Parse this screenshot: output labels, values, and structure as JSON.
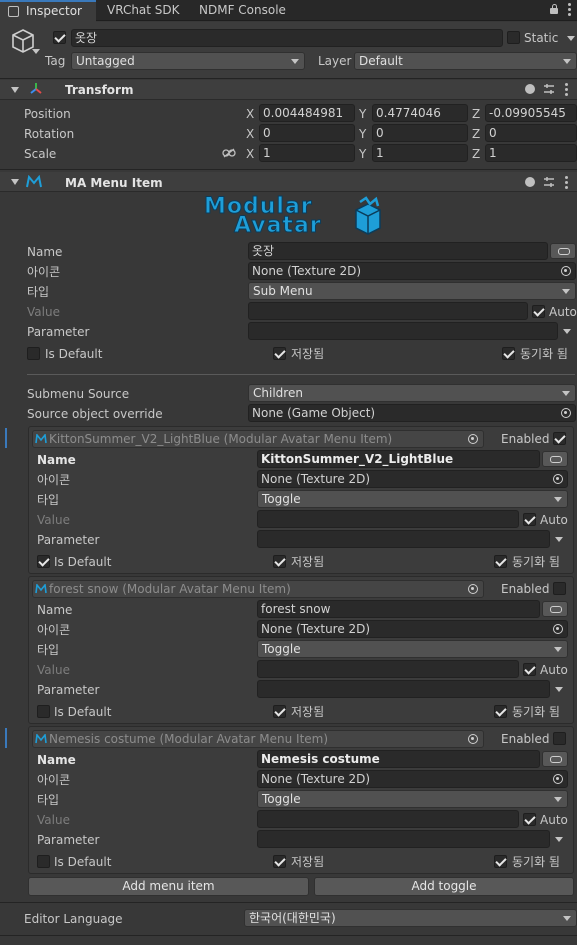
{
  "tabs": {
    "inspector": "Inspector",
    "vrchat_sdk": "VRChat SDK",
    "ndmf_console": "NDMF Console"
  },
  "object": {
    "name": "옷장",
    "static_label": "Static",
    "tag_label": "Tag",
    "tag_value": "Untagged",
    "layer_label": "Layer",
    "layer_value": "Default"
  },
  "transform": {
    "title": "Transform",
    "position_label": "Position",
    "rotation_label": "Rotation",
    "scale_label": "Scale",
    "x": "X",
    "y": "Y",
    "z": "Z",
    "position": [
      "0.004484981",
      "0.4774046",
      "-0.09905545"
    ],
    "rotation": [
      "0",
      "0",
      "0"
    ],
    "scale": [
      "1",
      "1",
      "1"
    ]
  },
  "menu_item": {
    "title": "MA Menu Item",
    "logo_line1": "Modular",
    "logo_line2": "Avatar",
    "name_label": "Name",
    "name_value": "옷장",
    "icon_label": "아이콘",
    "icon_value": "None (Texture 2D)",
    "type_label": "타입",
    "type_value": "Sub Menu",
    "value_label": "Value",
    "auto_label": "Auto",
    "parameter_label": "Parameter",
    "is_default_label": "Is Default",
    "saved_label": "저장됨",
    "synced_label": "동기화 됨",
    "submenu_source_label": "Submenu Source",
    "submenu_source_value": "Children",
    "source_override_label": "Source object override",
    "source_override_value": "None (Game Object)",
    "children": [
      {
        "header": "KittonSummer_V2_LightBlue (Modular Avatar Menu Item)",
        "enabled_label": "Enabled",
        "name_value": "KittonSummer_V2_LightBlue",
        "icon_value": "None (Texture 2D)",
        "type_value": "Toggle"
      },
      {
        "header": "forest snow (Modular Avatar Menu Item)",
        "enabled_label": "Enabled",
        "name_value": "forest snow",
        "icon_value": "None (Texture 2D)",
        "type_value": "Toggle"
      },
      {
        "header": "Nemesis costume (Modular Avatar Menu Item)",
        "enabled_label": "Enabled",
        "name_value": "Nemesis costume",
        "icon_value": "None (Texture 2D)",
        "type_value": "Toggle"
      }
    ],
    "add_menu_item": "Add menu item",
    "add_toggle": "Add toggle"
  },
  "editor_language": {
    "label": "Editor Language",
    "value": "한국어(대한민국)"
  },
  "colors": {
    "background": "#383838",
    "field": "#2a2a2a",
    "accent_blue": "#3a79bb",
    "logo_blue": "#1e9ed8"
  }
}
